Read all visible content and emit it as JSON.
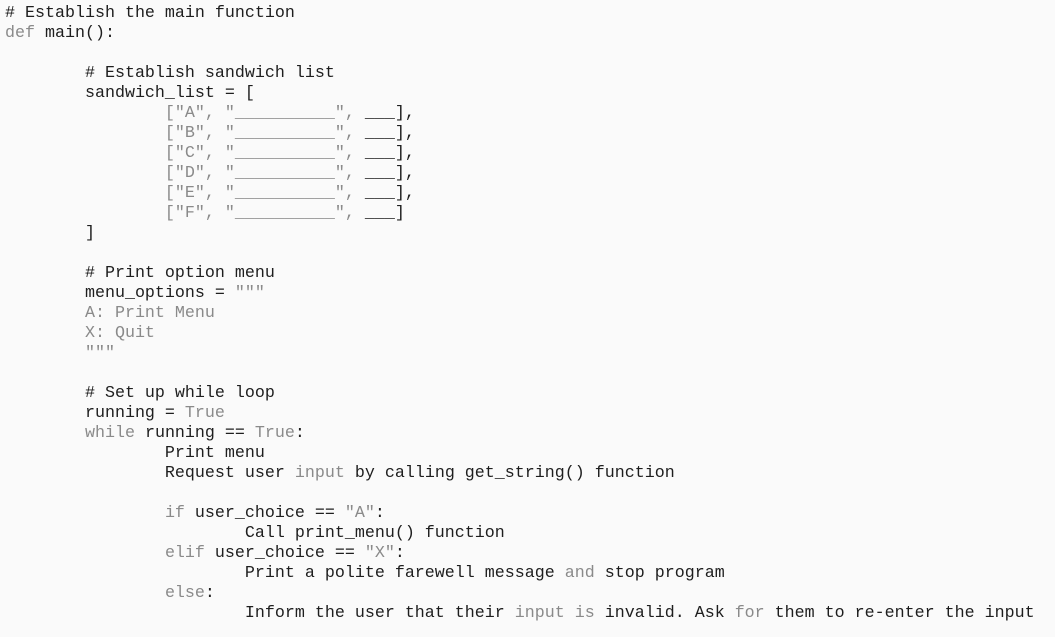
{
  "colors": {
    "text": "#1e1e1e",
    "keyword": "#8a8a8a",
    "background": "#fafafa"
  },
  "lines": [
    [
      {
        "t": "# Establish the main function",
        "c": "n"
      }
    ],
    [
      {
        "t": "def",
        "c": "k"
      },
      {
        "t": " main():",
        "c": "n"
      }
    ],
    [],
    [
      {
        "t": "        # Establish sandwich list",
        "c": "n"
      }
    ],
    [
      {
        "t": "        sandwich_list = [",
        "c": "n"
      }
    ],
    [
      {
        "t": "                [\"A\", \"__________\", ",
        "c": "k"
      },
      {
        "t": "___],",
        "c": "n"
      }
    ],
    [
      {
        "t": "                [\"B\", \"__________\", ",
        "c": "k"
      },
      {
        "t": "___],",
        "c": "n"
      }
    ],
    [
      {
        "t": "                [\"C\", \"__________\", ",
        "c": "k"
      },
      {
        "t": "___],",
        "c": "n"
      }
    ],
    [
      {
        "t": "                [\"D\", \"__________\", ",
        "c": "k"
      },
      {
        "t": "___],",
        "c": "n"
      }
    ],
    [
      {
        "t": "                [\"E\", \"__________\", ",
        "c": "k"
      },
      {
        "t": "___],",
        "c": "n"
      }
    ],
    [
      {
        "t": "                [\"F\", \"__________\", ",
        "c": "k"
      },
      {
        "t": "___]",
        "c": "n"
      }
    ],
    [
      {
        "t": "        ]",
        "c": "n"
      }
    ],
    [],
    [
      {
        "t": "        # Print option menu",
        "c": "n"
      }
    ],
    [
      {
        "t": "        menu_options = ",
        "c": "n"
      },
      {
        "t": "\"\"\"",
        "c": "k"
      }
    ],
    [
      {
        "t": "        A: Print Menu",
        "c": "k"
      }
    ],
    [
      {
        "t": "        X: Quit",
        "c": "k"
      }
    ],
    [
      {
        "t": "        \"\"\"",
        "c": "k"
      }
    ],
    [],
    [
      {
        "t": "        # Set up while loop",
        "c": "n"
      }
    ],
    [
      {
        "t": "        running = ",
        "c": "n"
      },
      {
        "t": "True",
        "c": "k"
      }
    ],
    [
      {
        "t": "        ",
        "c": "n"
      },
      {
        "t": "while",
        "c": "k"
      },
      {
        "t": " running == ",
        "c": "n"
      },
      {
        "t": "True",
        "c": "k"
      },
      {
        "t": ":",
        "c": "n"
      }
    ],
    [
      {
        "t": "                Print menu",
        "c": "n"
      }
    ],
    [
      {
        "t": "                Request user ",
        "c": "n"
      },
      {
        "t": "input",
        "c": "k"
      },
      {
        "t": " by calling get_string() function",
        "c": "n"
      }
    ],
    [],
    [
      {
        "t": "                ",
        "c": "n"
      },
      {
        "t": "if",
        "c": "k"
      },
      {
        "t": " user_choice == ",
        "c": "n"
      },
      {
        "t": "\"A\"",
        "c": "k"
      },
      {
        "t": ":",
        "c": "n"
      }
    ],
    [
      {
        "t": "                        Call print_menu() function",
        "c": "n"
      }
    ],
    [
      {
        "t": "                ",
        "c": "n"
      },
      {
        "t": "elif",
        "c": "k"
      },
      {
        "t": " user_choice == ",
        "c": "n"
      },
      {
        "t": "\"X\"",
        "c": "k"
      },
      {
        "t": ":",
        "c": "n"
      }
    ],
    [
      {
        "t": "                        Print a polite farewell message ",
        "c": "n"
      },
      {
        "t": "and",
        "c": "k"
      },
      {
        "t": " stop program",
        "c": "n"
      }
    ],
    [
      {
        "t": "                ",
        "c": "n"
      },
      {
        "t": "else",
        "c": "k"
      },
      {
        "t": ":",
        "c": "n"
      }
    ],
    [
      {
        "t": "                        Inform the user that their ",
        "c": "n"
      },
      {
        "t": "input",
        "c": "k"
      },
      {
        "t": " ",
        "c": "n"
      },
      {
        "t": "is",
        "c": "k"
      },
      {
        "t": " invalid. Ask ",
        "c": "n"
      },
      {
        "t": "for",
        "c": "k"
      },
      {
        "t": " them to re-enter the input",
        "c": "n"
      }
    ]
  ]
}
